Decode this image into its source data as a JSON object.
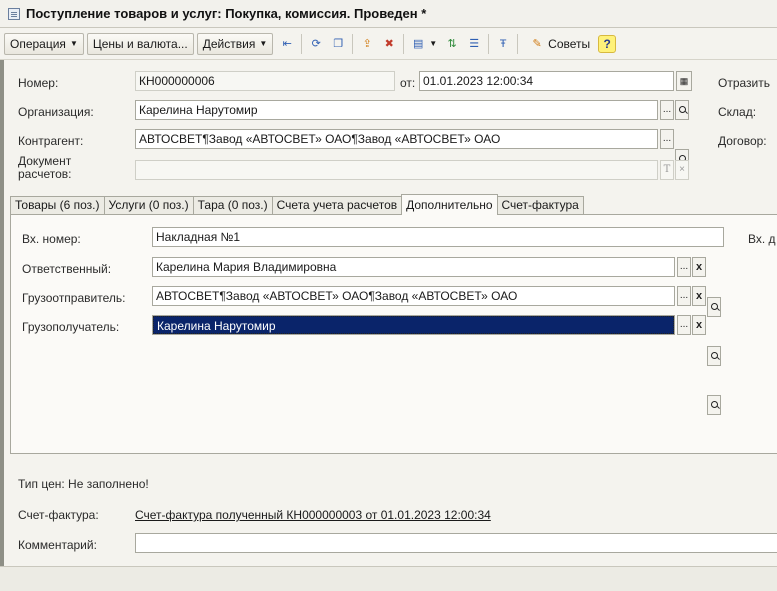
{
  "window": {
    "title": "Поступление товаров и услуг: Покупка, комиссия. Проведен *"
  },
  "toolbar": {
    "operation": "Операция",
    "prices": "Цены и валюта...",
    "actions": "Действия",
    "advice": "Советы",
    "help": "?",
    "icons": [
      "arrow-left-icon",
      "refresh-icon",
      "copy-icon",
      "upload-icon",
      "delete-icon",
      "dropdown-doc-icon",
      "ledger-icon",
      "report-icon",
      "tt-icon",
      "advice-icon"
    ]
  },
  "header": {
    "number_label": "Номер:",
    "number": "КН000000006",
    "date_label": "от:",
    "date": "01.01.2023 12:00:34",
    "reflect_label": "Отразить",
    "org_label": "Организация:",
    "org": "Карелина Нарутомир",
    "warehouse_label": "Склад:",
    "contractor_label": "Контрагент:",
    "contractor": "АВТОСВЕТ¶Завод «АВТОСВЕТ» ОАО¶Завод «АВТОСВЕТ» ОАО",
    "contract_label": "Договор:",
    "settlement_label": "Документ расчетов:",
    "settlement": "",
    "t_btn": "T",
    "x_btn": "×",
    "dots_btn": "...",
    "x_bold": "x"
  },
  "tabs": [
    {
      "label": "Товары (6 поз.)"
    },
    {
      "label": "Услуги (0 поз.)"
    },
    {
      "label": "Тара (0 поз.)"
    },
    {
      "label": "Счета учета расчетов"
    },
    {
      "label": "Дополнительно",
      "active": true
    },
    {
      "label": "Счет-фактура"
    }
  ],
  "additional": {
    "incoming_label": "Вх. номер:",
    "incoming": "Накладная №1",
    "incoming_date_label": "Вх. д",
    "responsible_label": "Ответственный:",
    "responsible": "Карелина Мария Владимировна",
    "shipper_label": "Грузоотправитель:",
    "shipper": "АВТОСВЕТ¶Завод «АВТОСВЕТ» ОАО¶Завод «АВТОСВЕТ» ОАО",
    "consignee_label": "Грузополучатель:",
    "consignee": "Карелина Нарутомир"
  },
  "footer": {
    "price_type": "Тип цен: Не заполнено!",
    "invoice_label": "Счет-фактура:",
    "invoice_link": "Счет-фактура полученный КН000000003 от 01.01.2023 12:00:34",
    "comment_label": "Комментарий:",
    "comment": ""
  }
}
